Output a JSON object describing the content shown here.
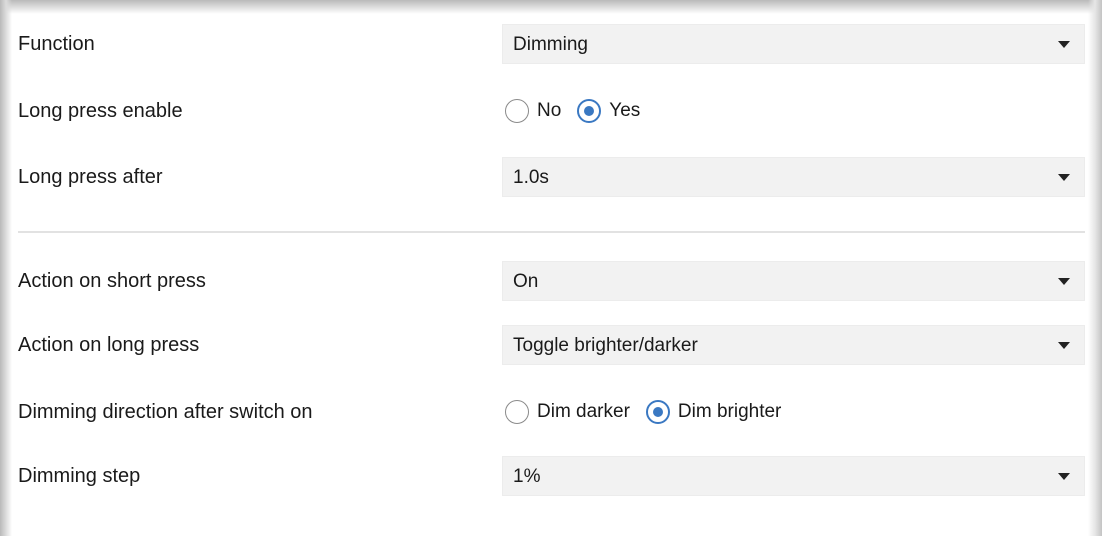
{
  "rows": [
    {
      "label": "Function",
      "type": "select",
      "value": "Dimming"
    },
    {
      "label": "Long press enable",
      "type": "radio",
      "options": [
        {
          "label": "No",
          "checked": false
        },
        {
          "label": "Yes",
          "checked": true
        }
      ]
    },
    {
      "label": "Long press after",
      "type": "select",
      "value": "1.0s"
    },
    {
      "label": "Action on short press",
      "type": "select",
      "value": "On"
    },
    {
      "label": "Action on long press",
      "type": "select",
      "value": "Toggle brighter/darker"
    },
    {
      "label": "Dimming direction after switch on",
      "type": "radio",
      "options": [
        {
          "label": "Dim darker",
          "checked": false
        },
        {
          "label": "Dim brighter",
          "checked": true
        }
      ]
    },
    {
      "label": "Dimming step",
      "type": "select",
      "value": "1%"
    }
  ],
  "colors": {
    "accent": "#3a78c2",
    "select_bg": "#f2f2f2",
    "divider": "#e2e2e2"
  },
  "icons": {
    "dropdown": "chevron-down-icon"
  }
}
